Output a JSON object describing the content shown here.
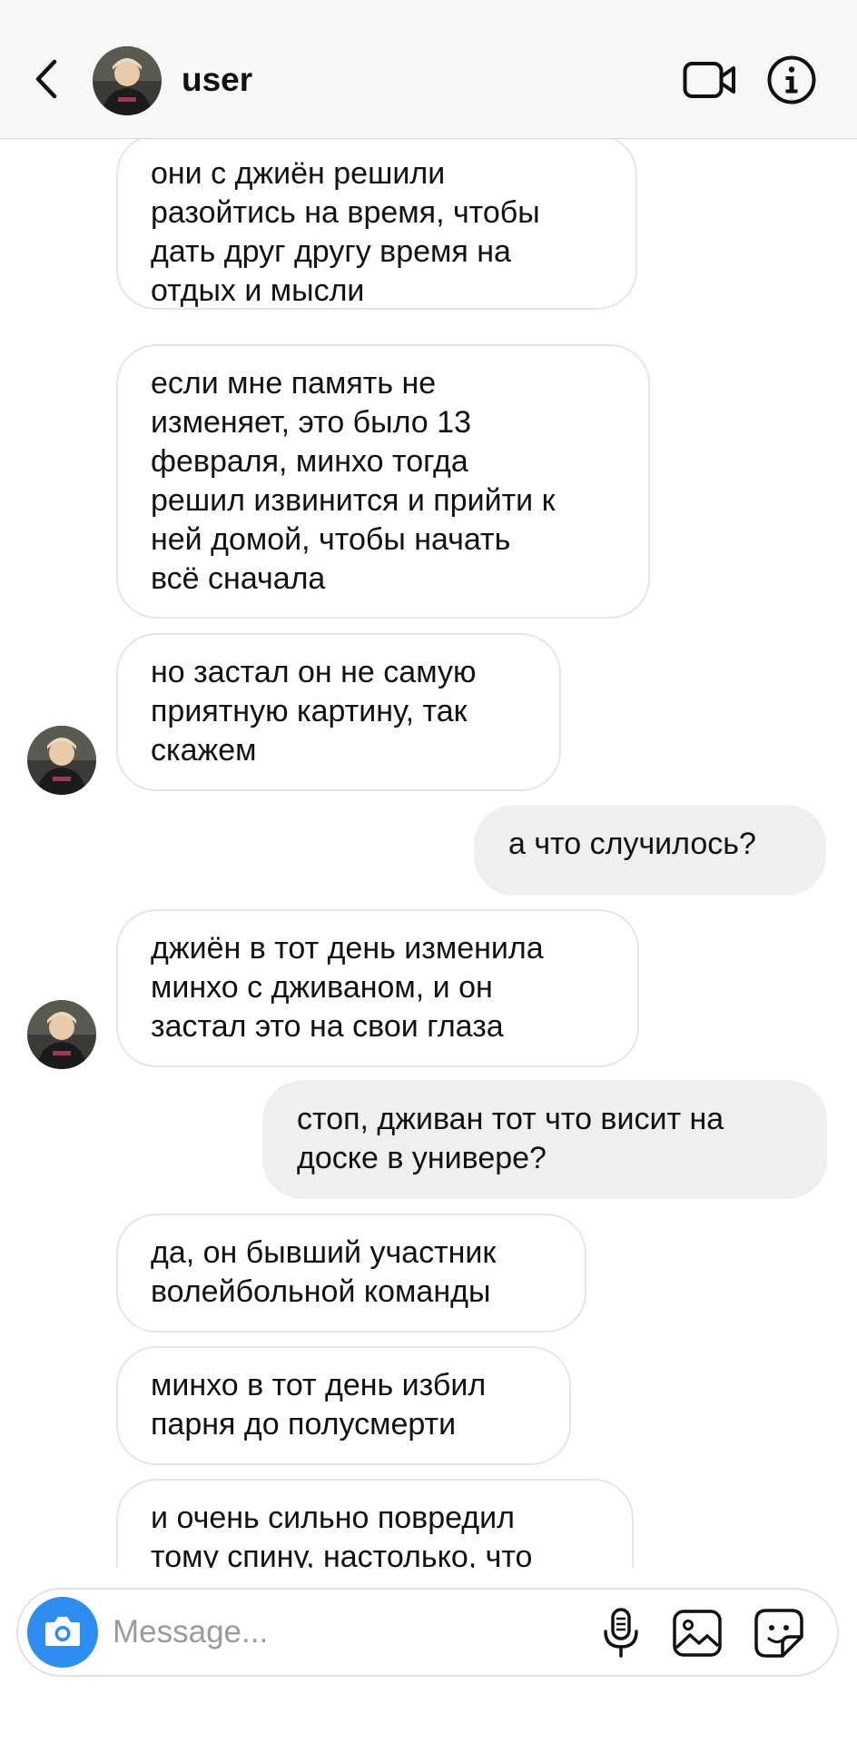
{
  "header": {
    "username": "user",
    "icons": [
      "chevron-left-icon",
      "avatar",
      "video-camera-icon",
      "info-icon"
    ]
  },
  "messages": [
    {
      "side": "incoming",
      "text": "они с джиён решили\nразойтись на время, чтобы\nдать друг другу время на\nотдых и мысли"
    },
    {
      "side": "incoming",
      "text": "если мне память не\nизменяет, это было 13\nфевраля, минхо тогда\nрешил извинится и прийти к\nней домой, чтобы начать\nвсё сначала"
    },
    {
      "side": "incoming",
      "text": "но застал он не самую\nприятную картину, так\nскажем"
    },
    {
      "side": "outgoing",
      "text": "а что случилось?"
    },
    {
      "side": "incoming",
      "text": "джиён в тот день изменила\nминхо с дживаном, и он\nзастал это на свои глаза"
    },
    {
      "side": "outgoing",
      "text": "стоп, дживан тот что висит на\nдоске в универе?"
    },
    {
      "side": "incoming",
      "text": "да, он бывший участник\nволейбольной команды"
    },
    {
      "side": "incoming",
      "text": "минхо в тот день избил\nпарня до полусмерти"
    },
    {
      "side": "incoming",
      "text": "и очень сильно повредил\nтому спину, настолько, что"
    }
  ],
  "composer": {
    "placeholder": "Message...",
    "icons": [
      "camera-icon",
      "microphone-icon",
      "gallery-icon",
      "sticker-icon"
    ]
  },
  "colors": {
    "header_bg": "#f7f7f8",
    "incoming_bubble_border": "#e6e6e9",
    "outgoing_bubble_bg": "#efeff1",
    "camera_button_bg": "#2e8ef0",
    "placeholder_text": "#9a9aa0"
  }
}
